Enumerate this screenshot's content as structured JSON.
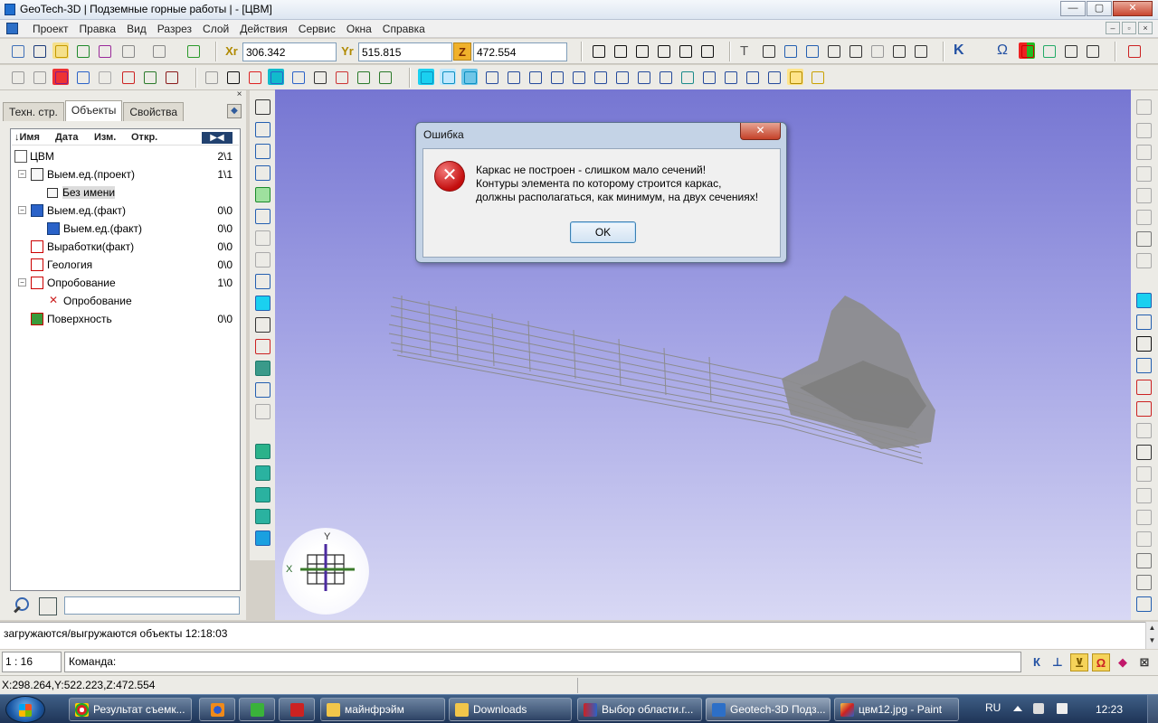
{
  "window": {
    "title": "GeoTech-3D | Подземные горные работы | - [ЦВМ]",
    "minimize_label": "—",
    "maximize_label": "▢",
    "close_label": "✕"
  },
  "menu": {
    "items": [
      "Проект",
      "Правка",
      "Вид",
      "Разрез",
      "Слой",
      "Действия",
      "Сервис",
      "Окна",
      "Справка"
    ],
    "mdi_minimize": "–",
    "mdi_restore": "▫",
    "mdi_close": "×"
  },
  "coords": {
    "x_label": "Xr",
    "x_value": "306.342",
    "y_label": "Yr",
    "y_value": "515.815",
    "z_label": "Z",
    "z_value": "472.554"
  },
  "toolbar_text": {
    "text_tool": "T",
    "k_tool": "K",
    "omega_tool": "Ω"
  },
  "panel": {
    "close_label": "×",
    "tabs": [
      "Техн. стр.",
      "Объекты",
      "Свойства"
    ],
    "active_tab": "Объекты",
    "tab_arrow": "◆",
    "columns": {
      "name": "Имя",
      "date": "Дата",
      "changed": "Изм.",
      "opened": "Откр."
    },
    "header_button": "▶◀",
    "tree": [
      {
        "label": "ЦВМ",
        "count": "2\\1"
      },
      {
        "label": "Выем.ед.(проект)",
        "count": "1\\1"
      },
      {
        "label": "Без имени",
        "count": ""
      },
      {
        "label": "Выем.ед.(факт)",
        "count": "0\\0"
      },
      {
        "label": "Выем.ед.(факт)",
        "count": "0\\0"
      },
      {
        "label": "Выработки(факт)",
        "count": "0\\0"
      },
      {
        "label": "Геология",
        "count": "0\\0"
      },
      {
        "label": "Опробование",
        "count": "1\\0"
      },
      {
        "label": "Опробование",
        "count": ""
      },
      {
        "label": "Поверхность",
        "count": "0\\0"
      }
    ],
    "expand_minus": "−",
    "search_value": ""
  },
  "viewport": {
    "axis_x": "X",
    "axis_y": "Y",
    "colors": {
      "background_top": "#7676d2",
      "background_bottom": "#d8d8f4",
      "model": "#888888"
    }
  },
  "dialog": {
    "title": "Ошибка",
    "close_label": "✕",
    "icon_glyph": "✕",
    "message_line1": "Каркас не построен - слишком мало сечений!",
    "message_line2": "Контуры элемента по которому строится каркас,",
    "message_line3": "должны располагаться, как минимум, на двух сечениях!",
    "ok_label": "OK"
  },
  "log": {
    "message": "загружаются/выгружаются объекты 12:18:03",
    "scroll_up": "▲",
    "scroll_down": "▼"
  },
  "command": {
    "scale": "1 : 16",
    "prompt": "Команда:",
    "snap_k": "К",
    "snap_perp": "⊥",
    "snap_yellow": "⊻",
    "snap_magnet": "Ω",
    "snap_diamond": "◆",
    "snap_grid": "⊠"
  },
  "status": {
    "coords": "X:298.264,Y:522.223,Z:472.554"
  },
  "taskbar": {
    "tasks": [
      {
        "label": "Результат съемк..."
      },
      {
        "label": "майнфрэйм"
      },
      {
        "label": "Downloads"
      },
      {
        "label": "Выбор области.г..."
      },
      {
        "label": "Geotech-3D Подз..."
      },
      {
        "label": "цвм12.jpg - Paint"
      }
    ],
    "lang": "RU",
    "clock": "12:23"
  }
}
